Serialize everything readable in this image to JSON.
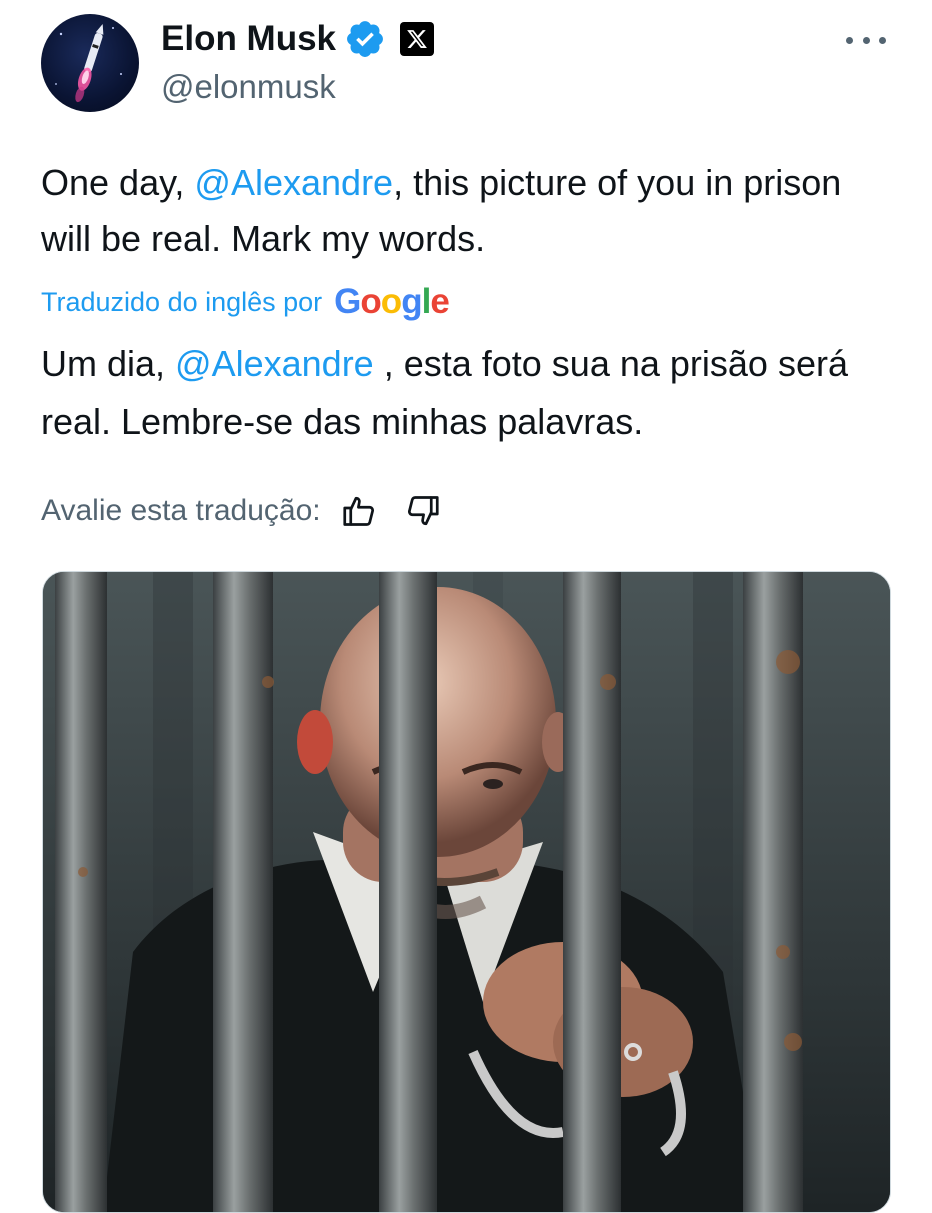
{
  "author": {
    "display_name": "Elon Musk",
    "handle": "@elonmusk",
    "verified": true,
    "verified_icon": "verified-badge-icon",
    "affiliate_icon": "x-logo-icon",
    "more_icon": "more-icon"
  },
  "tweet": {
    "text_part1": "One day, ",
    "mention": "@Alexandre",
    "text_part2": ", this picture of you in prison will be real. Mark my words."
  },
  "translation": {
    "label": "Traduzido do inglês por",
    "provider": "Google",
    "text_part1": "Um dia, ",
    "mention": "@Alexandre",
    "text_part2": " , esta foto sua na prisão será real. Lembre-se das minhas palavras.",
    "rate_label": "Avalie esta tradução:",
    "thumbs_up_icon": "thumbs-up-icon",
    "thumbs_down_icon": "thumbs-down-icon"
  },
  "colors": {
    "accent": "#1d9bf0",
    "text": "#0f1419",
    "secondary": "#536471"
  }
}
